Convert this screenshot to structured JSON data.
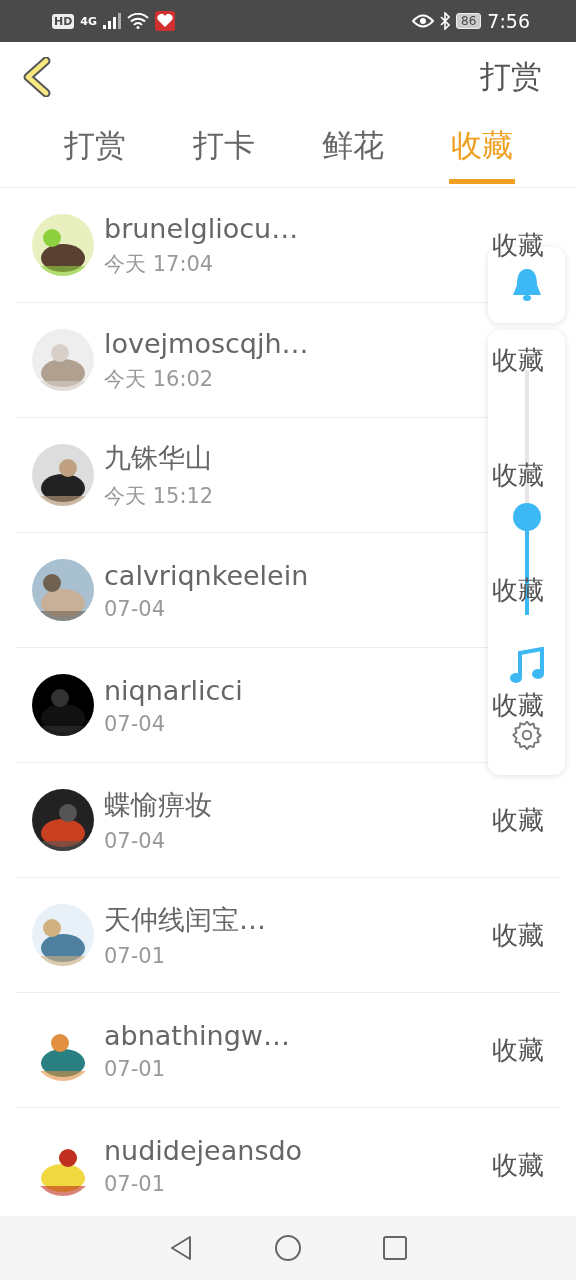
{
  "status_bar": {
    "hd": "HD",
    "network": "4G",
    "battery": "86",
    "time": "7:56"
  },
  "header": {
    "title": "打赏"
  },
  "tabs": [
    {
      "label": "打赏",
      "selected": false
    },
    {
      "label": "打卡",
      "selected": false
    },
    {
      "label": "鲜花",
      "selected": false
    },
    {
      "label": "收藏",
      "selected": true
    }
  ],
  "rows": [
    {
      "name": "brunelgliocu…",
      "time": "今天 17:04",
      "action": "收藏"
    },
    {
      "name": "lovejmoscqjh…",
      "time": "今天 16:02",
      "action": "收藏"
    },
    {
      "name": "九铢华山",
      "time": "今天 15:12",
      "action": "收藏"
    },
    {
      "name": "calvriqnkeelein",
      "time": "07-04",
      "action": "收藏"
    },
    {
      "name": "niqnarlicci",
      "time": "07-04",
      "action": "收藏"
    },
    {
      "name": "蝶愉痹妆",
      "time": "07-04",
      "action": "收藏"
    },
    {
      "name": "天仲线闰宝…",
      "time": "07-01",
      "action": "收藏"
    },
    {
      "name": "abnathingw…",
      "time": "07-01",
      "action": "收藏"
    },
    {
      "name": "nudidejeansdo",
      "time": "07-01",
      "action": "收藏"
    }
  ],
  "volume_panel": {
    "level": 0.4
  }
}
